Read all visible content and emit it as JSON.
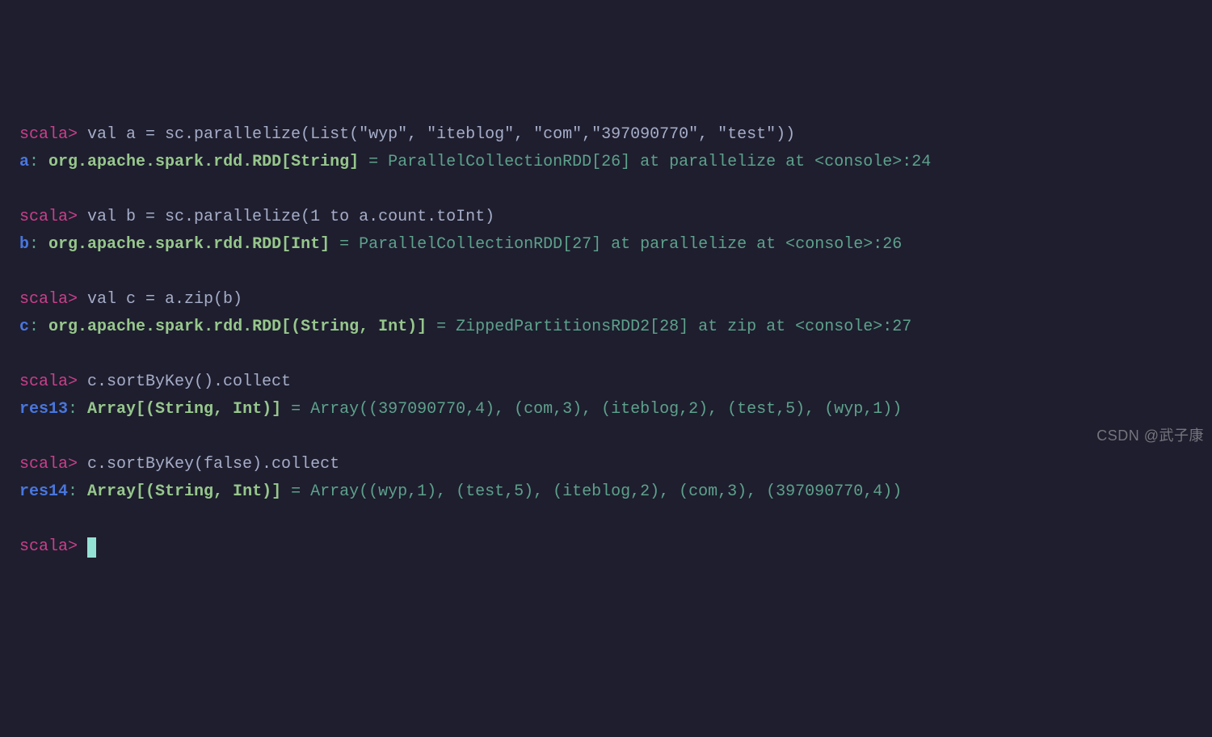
{
  "prompt": "scala>",
  "lines": [
    {
      "type": "cmd",
      "text": " val a = sc.parallelize(List(\"wyp\", \"iteblog\", \"com\",\"397090770\", \"test\"))"
    },
    {
      "type": "result",
      "var": "a",
      "decl": "org.apache.spark.rdd.RDD[String]",
      "value": "ParallelCollectionRDD[26] at parallelize at <console>:24"
    },
    {
      "type": "blank"
    },
    {
      "type": "cmd",
      "text": " val b = sc.parallelize(1 to a.count.toInt)"
    },
    {
      "type": "result",
      "var": "b",
      "decl": "org.apache.spark.rdd.RDD[Int]",
      "value": "ParallelCollectionRDD[27] at parallelize at <console>:26"
    },
    {
      "type": "blank"
    },
    {
      "type": "cmd",
      "text": " val c = a.zip(b)"
    },
    {
      "type": "result",
      "var": "c",
      "decl": "org.apache.spark.rdd.RDD[(String, Int)]",
      "value": "ZippedPartitionsRDD2[28] at zip at <console>:27"
    },
    {
      "type": "blank"
    },
    {
      "type": "cmd",
      "text": " c.sortByKey().collect"
    },
    {
      "type": "result",
      "var": "res13",
      "decl": "Array[(String, Int)]",
      "value": "Array((397090770,4), (com,3), (iteblog,2), (test,5), (wyp,1))"
    },
    {
      "type": "blank"
    },
    {
      "type": "cmd",
      "text": " c.sortByKey(false).collect"
    },
    {
      "type": "result",
      "var": "res14",
      "decl": "Array[(String, Int)]",
      "value": "Array((wyp,1), (test,5), (iteblog,2), (com,3), (397090770,4))"
    },
    {
      "type": "blank"
    },
    {
      "type": "cursor"
    }
  ],
  "watermark": "CSDN @武子康"
}
